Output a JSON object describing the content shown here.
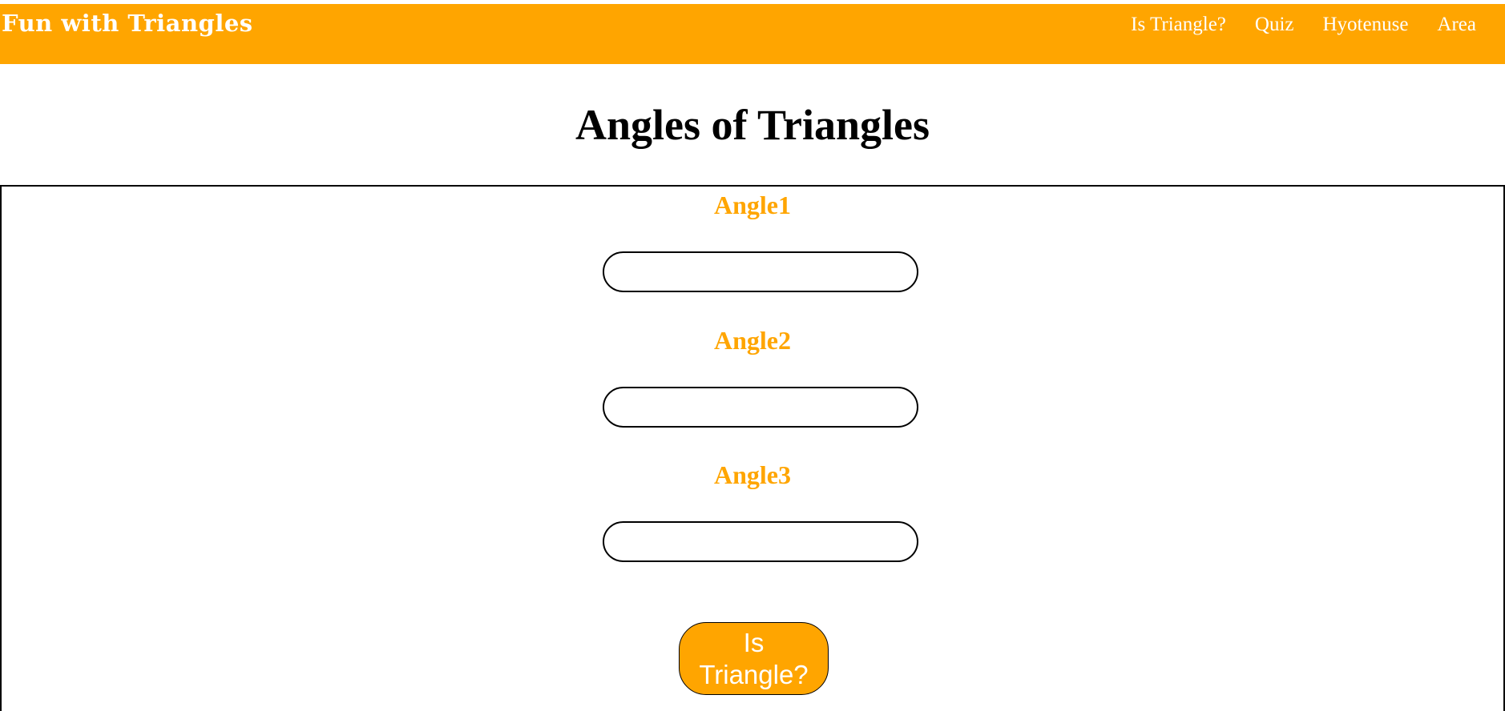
{
  "navbar": {
    "brand": "Fun with Triangles",
    "links": [
      "Is Triangle?",
      "Quiz",
      "Hyotenuse",
      "Area"
    ],
    "background_color": "#FFA500"
  },
  "main": {
    "title": "Angles of Triangles",
    "fields": [
      {
        "label": "Angle1",
        "value": ""
      },
      {
        "label": "Angle2",
        "value": ""
      },
      {
        "label": "Angle3",
        "value": ""
      }
    ],
    "submit_label": "Is Triangle?",
    "accent_color": "#FFA500"
  }
}
